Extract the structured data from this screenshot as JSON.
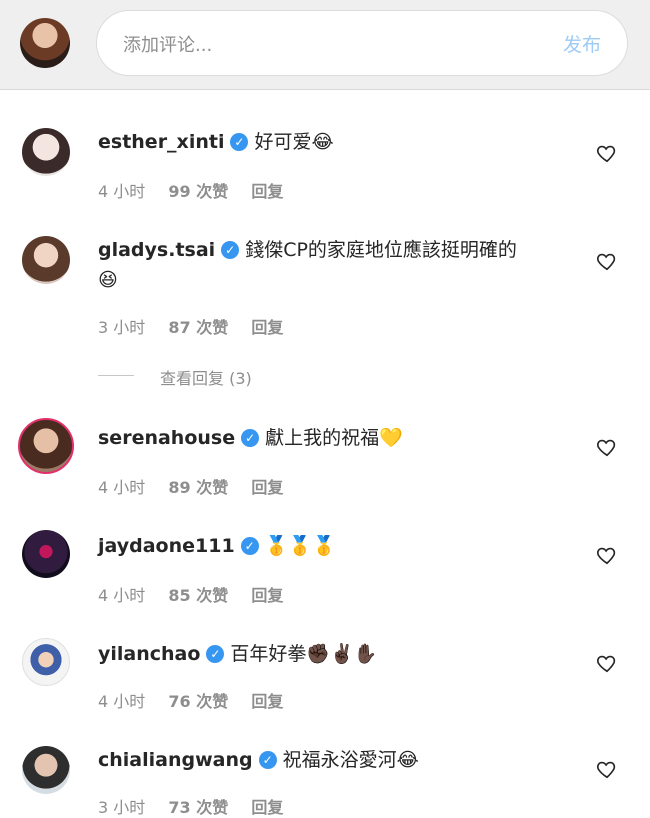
{
  "header": {
    "placeholder": "添加评论...",
    "post_label": "发布"
  },
  "comments": [
    {
      "user": "esther_xinti",
      "text": "好可爱😂",
      "time": "4 小时",
      "likes": "99 次赞",
      "reply": "回复"
    },
    {
      "user": "gladys.tsai",
      "text_line1": "錢傑CP的家庭地位應該挺明確的",
      "text_line2": "😆",
      "time": "3 小时",
      "likes": "87 次赞",
      "reply": "回复",
      "view_replies": "查看回复 (3)"
    },
    {
      "user": "serenahouse",
      "text": "獻上我的祝福💛",
      "time": "4 小时",
      "likes": "89 次赞",
      "reply": "回复"
    },
    {
      "user": "jaydaone111",
      "text": "🥇🥇🥇",
      "time": "4 小时",
      "likes": "85 次赞",
      "reply": "回复"
    },
    {
      "user": "yilanchao",
      "text": "百年好拳✊🏿✌🏿✋🏿",
      "time": "4 小时",
      "likes": "76 次赞",
      "reply": "回复"
    },
    {
      "user": "chialiangwang",
      "text": "祝福永浴愛河😂",
      "time": "3 小时",
      "likes": "73 次赞",
      "reply": "回复"
    }
  ],
  "icons": {
    "heart": "heart-outline-icon",
    "verified": "verified-badge-icon"
  },
  "colors": {
    "verified": "#3797f0",
    "post_disabled": "#9ecbf5",
    "meta": "#8e8e8e"
  }
}
